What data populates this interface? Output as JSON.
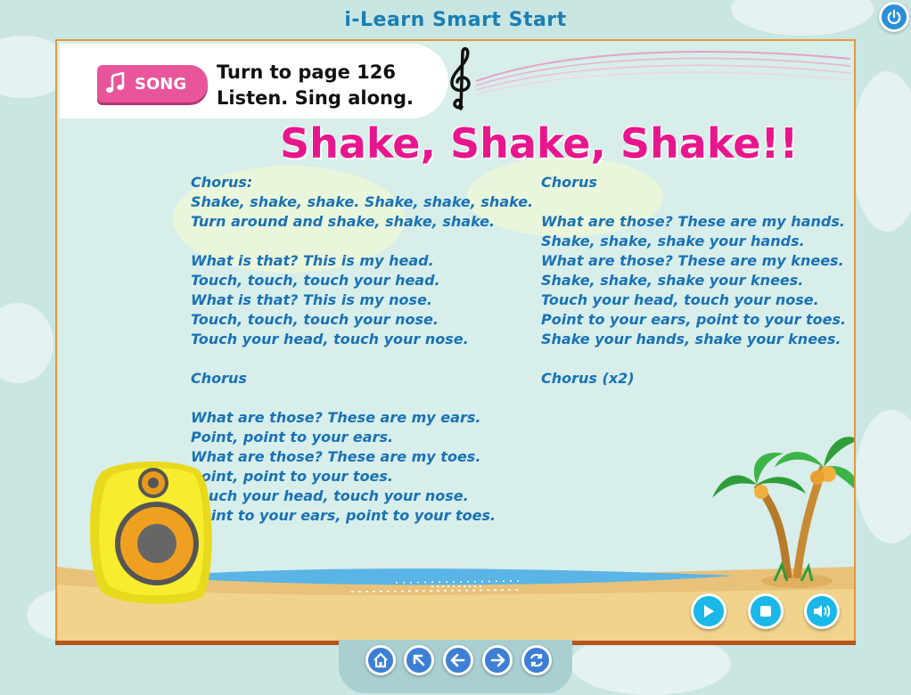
{
  "app": {
    "title": "i-Learn Smart Start"
  },
  "header": {
    "badge_label": "SONG",
    "instruction_line1": "Turn to page 126",
    "instruction_line2": "Listen. Sing along."
  },
  "song": {
    "title": "Shake, Shake, Shake!!",
    "left_column": [
      "Chorus:",
      "Shake, shake, shake. Shake, shake, shake.",
      "Turn around and shake, shake, shake.",
      "",
      "What is that? This is my head.",
      "Touch, touch, touch your head.",
      "What is that? This is my nose.",
      "Touch, touch, touch your nose.",
      "Touch your head, touch your nose.",
      "",
      "Chorus",
      "",
      "What are those? These are my ears.",
      "Point, point to your ears.",
      "What are those? These are my toes.",
      "Point, point to your toes.",
      "Touch your head, touch your nose.",
      "Point to your ears, point to your toes."
    ],
    "right_column": [
      "Chorus",
      "",
      "What are those? These are my hands.",
      "Shake, shake, shake your hands.",
      "What are those? These are my knees.",
      "Shake, shake, shake your knees.",
      "Touch your head, touch your nose.",
      "Point to your ears, point to your toes.",
      "Shake your hands, shake your knees.",
      "",
      "Chorus (x2)"
    ]
  },
  "controls": {
    "play": "play-icon",
    "stop": "stop-icon",
    "volume": "volume-icon"
  },
  "nav": {
    "home": "home-icon",
    "up": "arrow-up-left-icon",
    "back": "arrow-left-icon",
    "forward": "arrow-right-icon",
    "refresh": "refresh-icon"
  },
  "colors": {
    "accent_pink": "#e8168c",
    "lyrics_blue": "#1a72b5",
    "frame_orange": "#e8963a",
    "button_blue": "#19b8e8"
  }
}
